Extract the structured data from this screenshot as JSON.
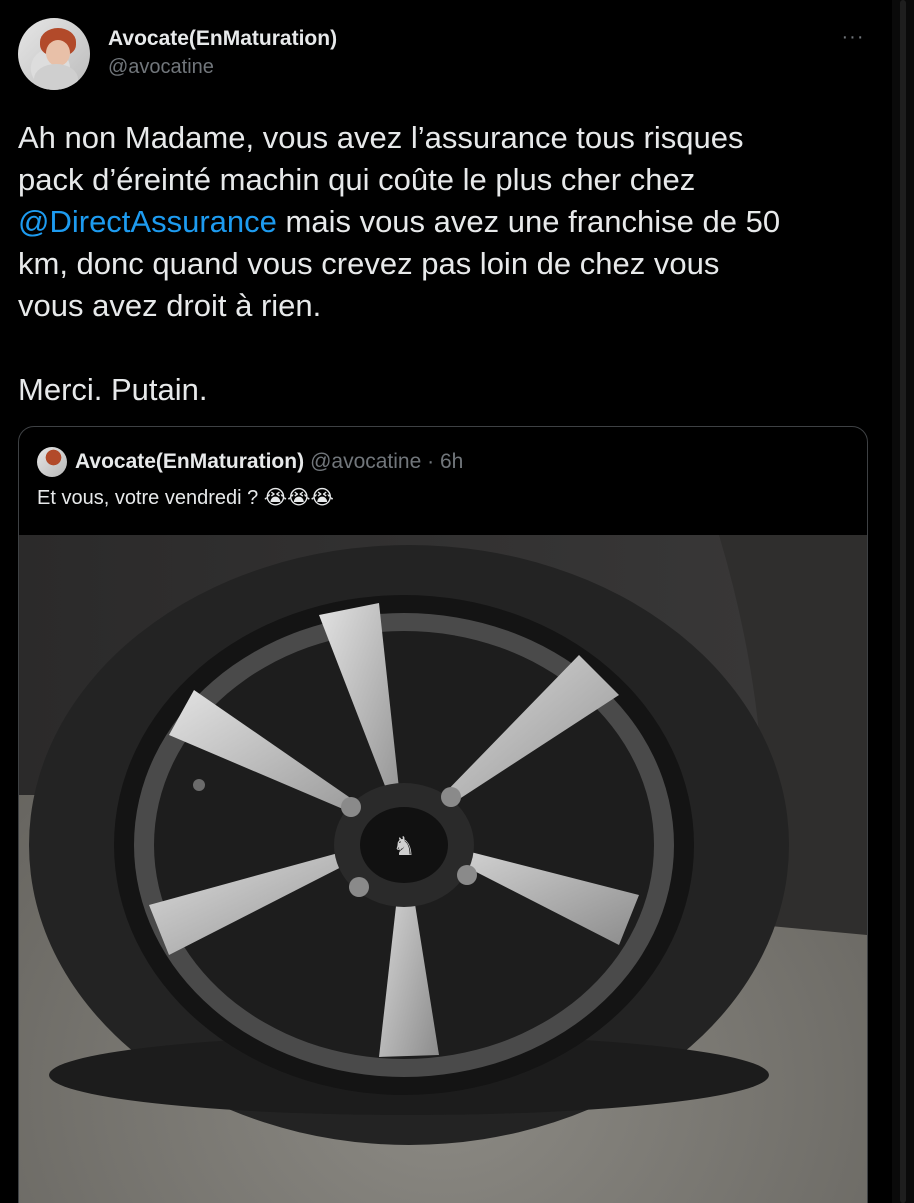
{
  "author": {
    "display_name": "Avocate(EnMaturation)",
    "handle": "@avocatine"
  },
  "more_icon": "···",
  "tweet": {
    "line_pre": "Ah non Madame, vous avez l’assurance tous risques\npack d’éreinté machin qui coûte le plus cher chez\n",
    "mention": "@DirectAssurance",
    "line_post": " mais vous avez une franchise de 50\nkm, donc quand vous crevez pas loin de chez vous\nvous avez droit à rien.\n\nMerci. Putain."
  },
  "quoted": {
    "display_name": "Avocate(EnMaturation)",
    "handle_time": "@avocatine · 6h",
    "text": "Et vous, votre vendredi ? 😭😭😭",
    "image": "flat-tire-photo"
  },
  "colors": {
    "background": "#000000",
    "text": "#e7e9ea",
    "muted": "#71767b",
    "link": "#1d9bf0",
    "border": "#3e4144"
  }
}
